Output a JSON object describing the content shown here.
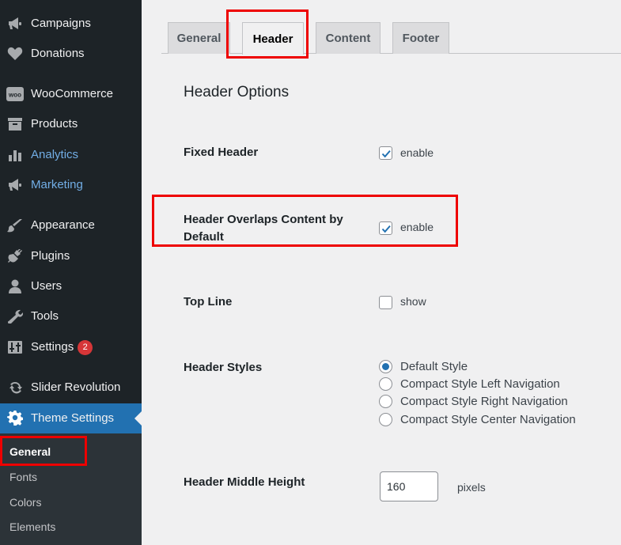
{
  "sidebar": {
    "items": [
      {
        "label": "Campaigns",
        "icon": "megaphone-icon"
      },
      {
        "label": "Donations",
        "icon": "heart-icon"
      },
      {
        "label": "WooCommerce",
        "icon": "woo-icon",
        "icon_text": "woo"
      },
      {
        "label": "Products",
        "icon": "archive-icon"
      },
      {
        "label": "Analytics",
        "icon": "bar-chart-icon"
      },
      {
        "label": "Marketing",
        "icon": "megaphone-icon"
      },
      {
        "label": "Appearance",
        "icon": "paintbrush-icon"
      },
      {
        "label": "Plugins",
        "icon": "plug-icon"
      },
      {
        "label": "Users",
        "icon": "user-icon"
      },
      {
        "label": "Tools",
        "icon": "wrench-icon"
      },
      {
        "label": "Settings",
        "icon": "sliders-icon",
        "badge": "2"
      },
      {
        "label": "Slider Revolution",
        "icon": "refresh-icon"
      },
      {
        "label": "Theme Settings",
        "icon": "gear-icon"
      }
    ],
    "submenu": [
      "General",
      "Fonts",
      "Colors",
      "Elements"
    ]
  },
  "tabs": [
    "General",
    "Header",
    "Content",
    "Footer"
  ],
  "section_title": "Header Options",
  "fields": {
    "fixed_header": {
      "label": "Fixed Header",
      "option": "enable",
      "checked": true
    },
    "overlaps": {
      "label_line1": "Header Overlaps Content by",
      "label_line2": "Default",
      "option": "enable",
      "checked": true
    },
    "top_line": {
      "label": "Top Line",
      "option": "show",
      "checked": false
    },
    "styles": {
      "label": "Header Styles",
      "options": [
        "Default Style",
        "Compact Style Left Navigation",
        "Compact Style Right Navigation",
        "Compact Style Center Navigation"
      ],
      "selected": "Default Style"
    },
    "middle_height": {
      "label": "Header Middle Height",
      "value": "160",
      "unit": "pixels"
    }
  },
  "colors": {
    "sidebar_bg": "#1d2327",
    "submenu_bg": "#2c3338",
    "accent": "#2271b1",
    "highlight_text": "#72aee6",
    "badge": "#d63638",
    "annotation": "#ee0000"
  }
}
